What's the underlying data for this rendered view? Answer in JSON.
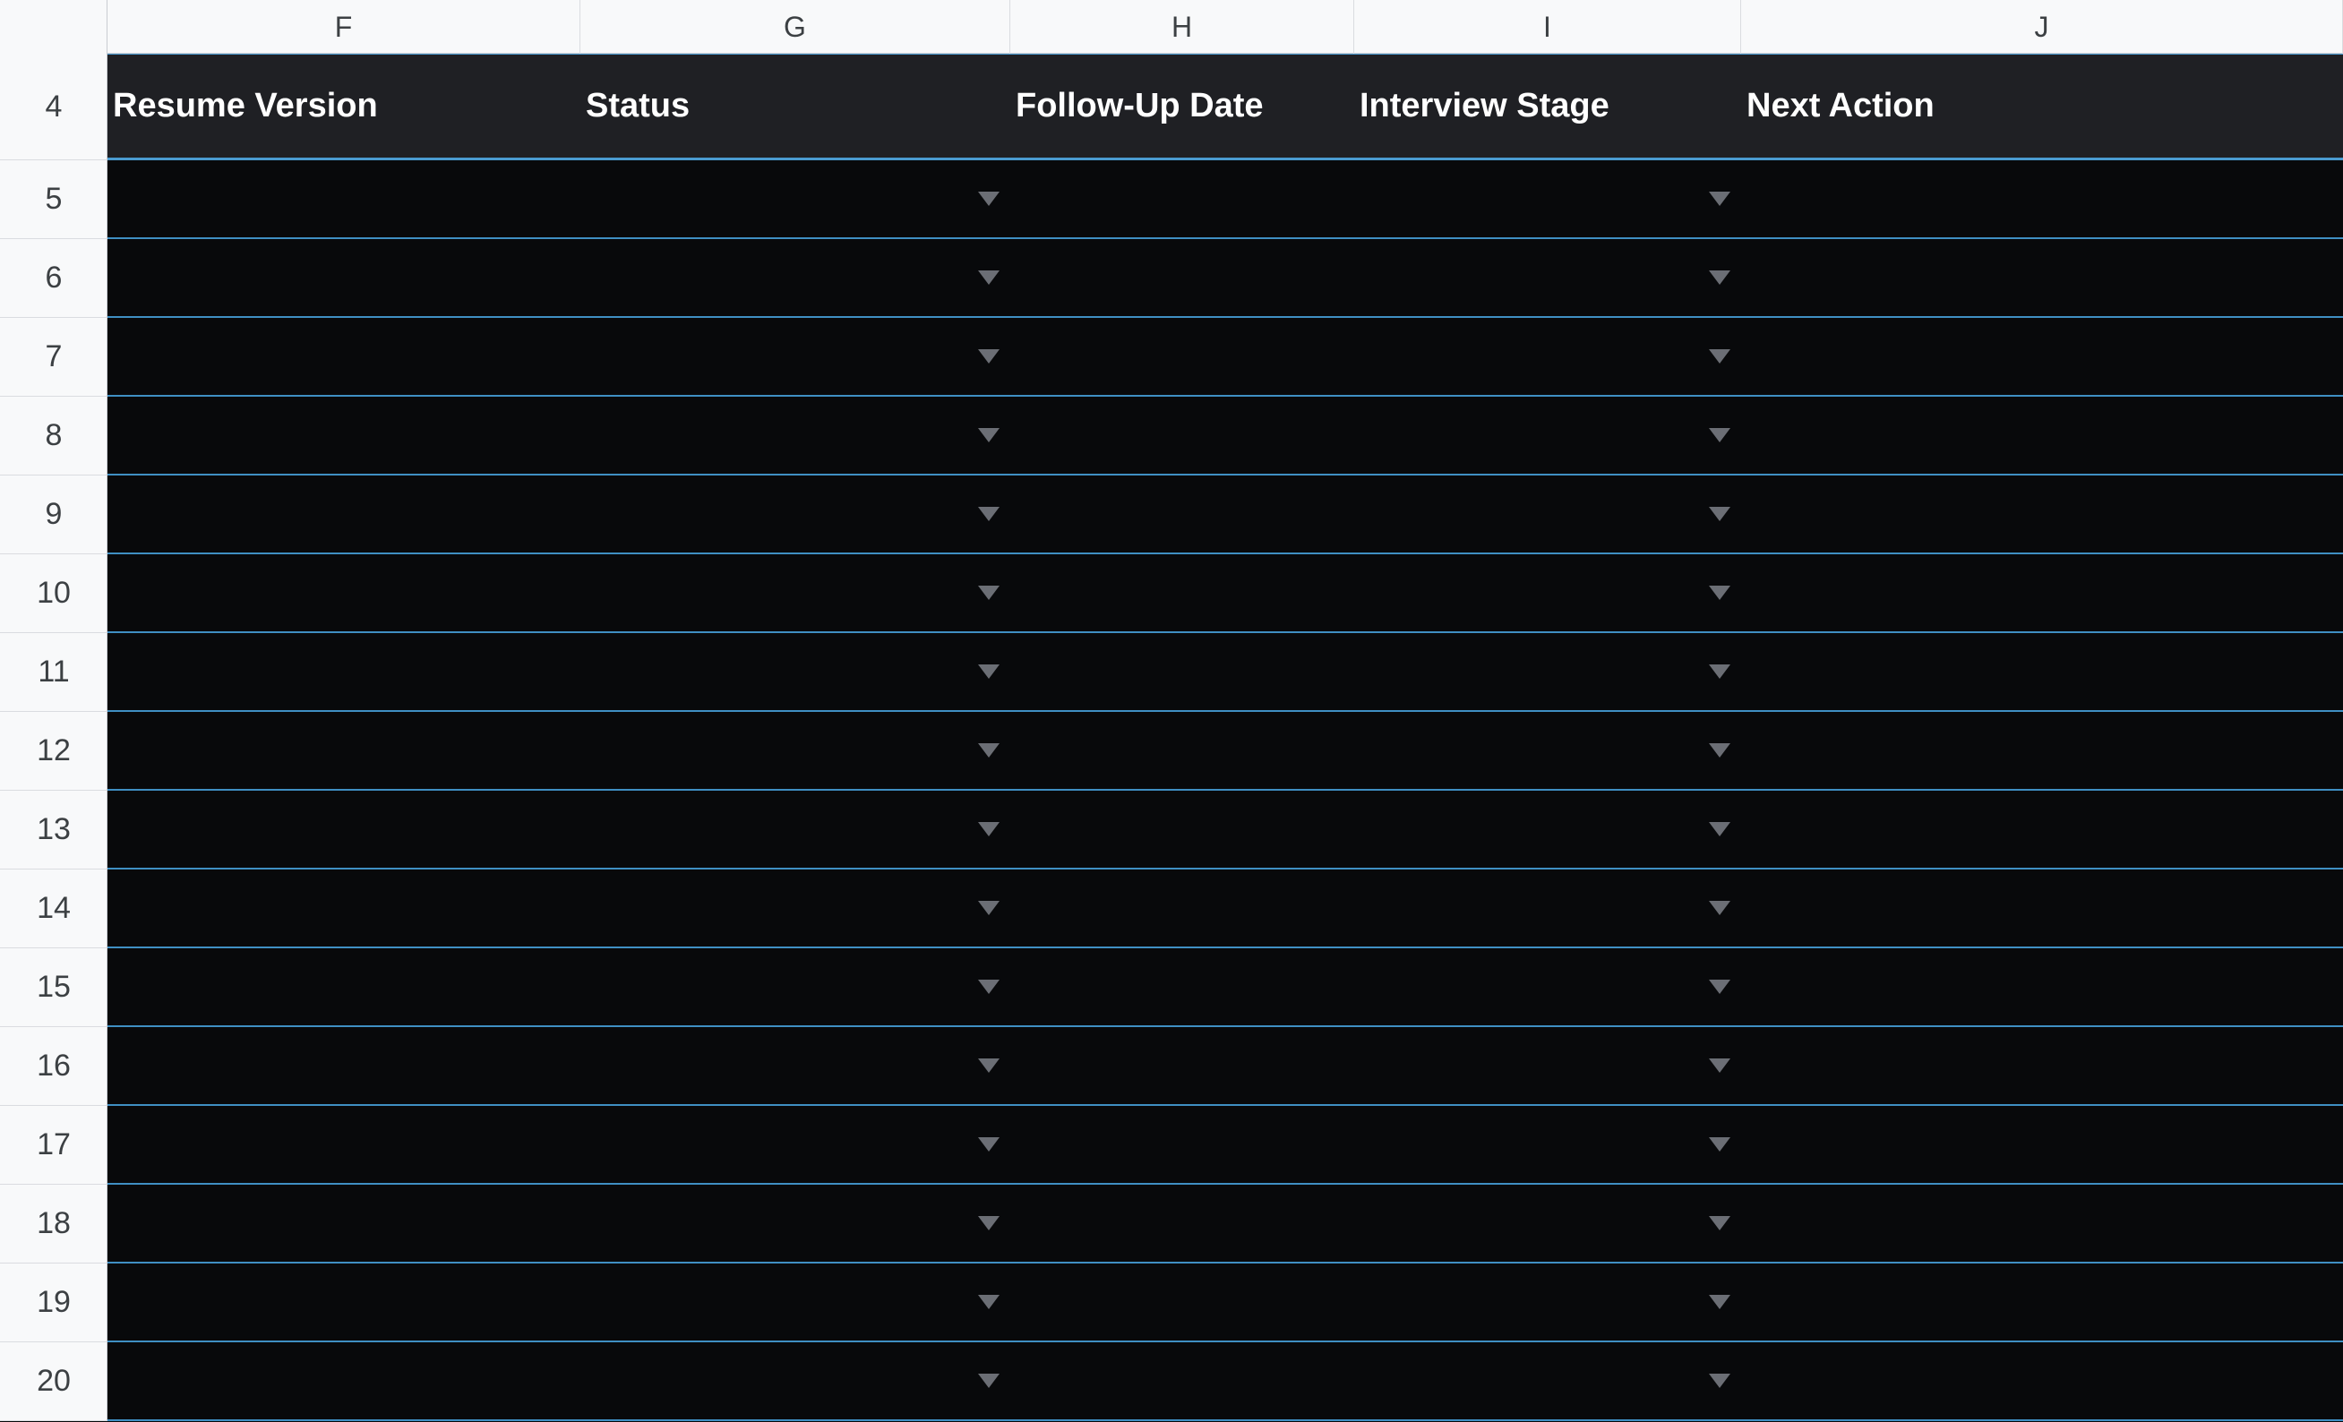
{
  "columns": [
    "F",
    "G",
    "H",
    "I",
    "J"
  ],
  "header_row_number": "4",
  "headers": {
    "resume_version": "Resume Version",
    "status": "Status",
    "follow_up_date": "Follow-Up Date",
    "interview_stage": "Interview Stage",
    "next_action": "Next Action"
  },
  "rows": [
    "5",
    "6",
    "7",
    "8",
    "9",
    "10",
    "11",
    "12",
    "13",
    "14",
    "15",
    "16",
    "17",
    "18",
    "19",
    "20"
  ],
  "dropdown_icon": "triangle-down",
  "colors": {
    "header_bg": "#1f2024",
    "body_bg": "#08090b",
    "row_border": "#3f8fc3",
    "dropdown_arrow": "#6b6e75"
  }
}
